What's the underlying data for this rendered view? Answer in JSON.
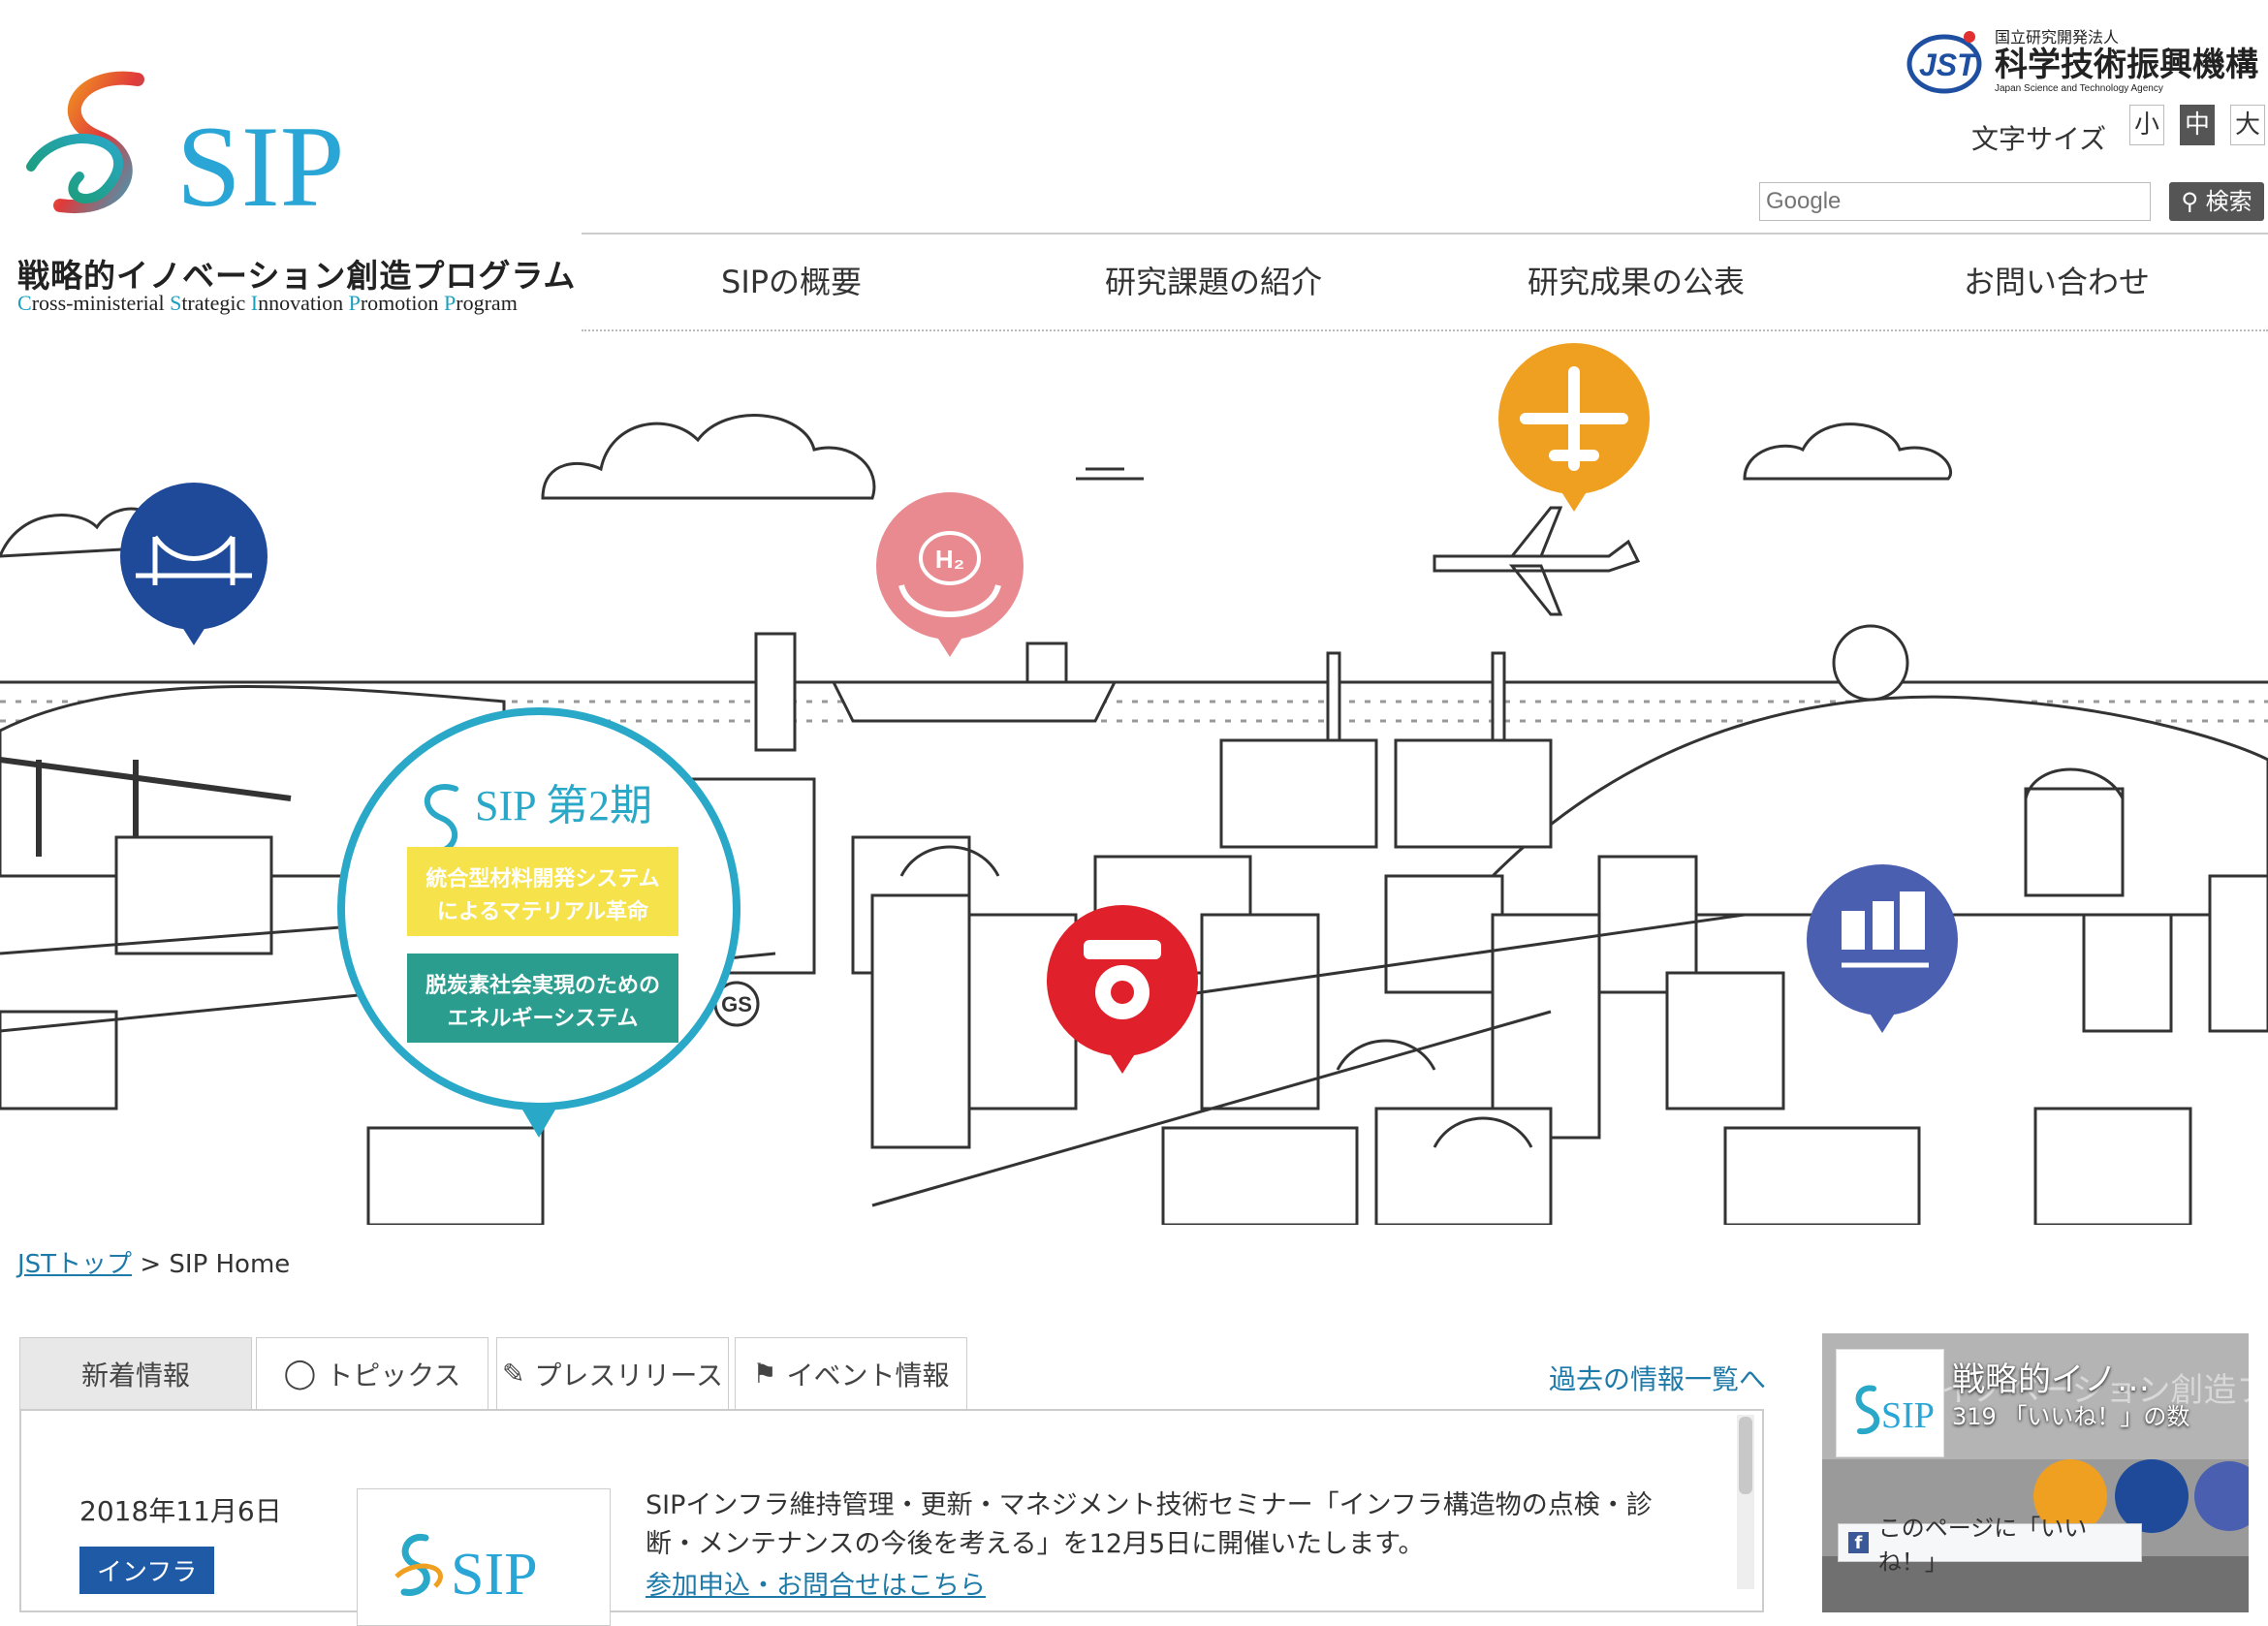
{
  "header": {
    "program_name_jp": "戦略的イノベーション創造プログラム",
    "program_name_en": [
      "C",
      "ross-ministerial ",
      "S",
      "trategic ",
      "I",
      "nnovation ",
      "P",
      "romotion ",
      "P",
      "rogram"
    ],
    "logo_text": "SIP",
    "jst_org_small": "国立研究開発法人",
    "jst_org_name": "科学技術振興機構",
    "jst_org_en": "Japan Science and Technology Agency",
    "font_size_label": "文字サイズ",
    "font_sizes": [
      "小",
      "中",
      "大"
    ],
    "font_size_selected": "中",
    "search_placeholder": "Google",
    "search_button": "検索"
  },
  "nav": [
    "SIPの概要",
    "研究課題の紹介",
    "研究成果の公表",
    "お問い合わせ"
  ],
  "hero": {
    "badge_title": "SIP 第2期",
    "item1": [
      "統合型材料開発システム",
      "によるマテリアル革命"
    ],
    "item2": [
      "脱炭素社会実現のための",
      "エネルギーシステム"
    ],
    "h2_label": "H₂",
    "gs_label": "GS"
  },
  "breadcrumb": {
    "home": "JSTトップ",
    "sep": ">",
    "current": "SIP Home"
  },
  "tabs": [
    "新着情報",
    "トピックス",
    "プレスリリース",
    "イベント情報"
  ],
  "past_link": "過去の情報一覧へ",
  "news": {
    "date": "2018年11月6日",
    "tag": "インフラ",
    "text": "SIPインフラ維持管理・更新・マネジメント技術セミナー「インフラ構造物の点検・診断・メンテナンスの今後を考える」を12月5日に開催いたします。",
    "link": "参加申込・お問合せはこちら"
  },
  "facebook": {
    "title": "戦略的イノ…",
    "likes": "319 「いいね！」の数",
    "like_button": "このページに「いいね！」",
    "bg_text": "戦略的イノベーション創造プログラ"
  },
  "colors": {
    "accent_teal": "#2aa8c8",
    "orange": "#f0a020",
    "red": "#e0202a",
    "navy": "#1f4a9a",
    "pink": "#e88a90",
    "purple_blue": "#4a5fb0",
    "link": "#1e7aa8"
  }
}
